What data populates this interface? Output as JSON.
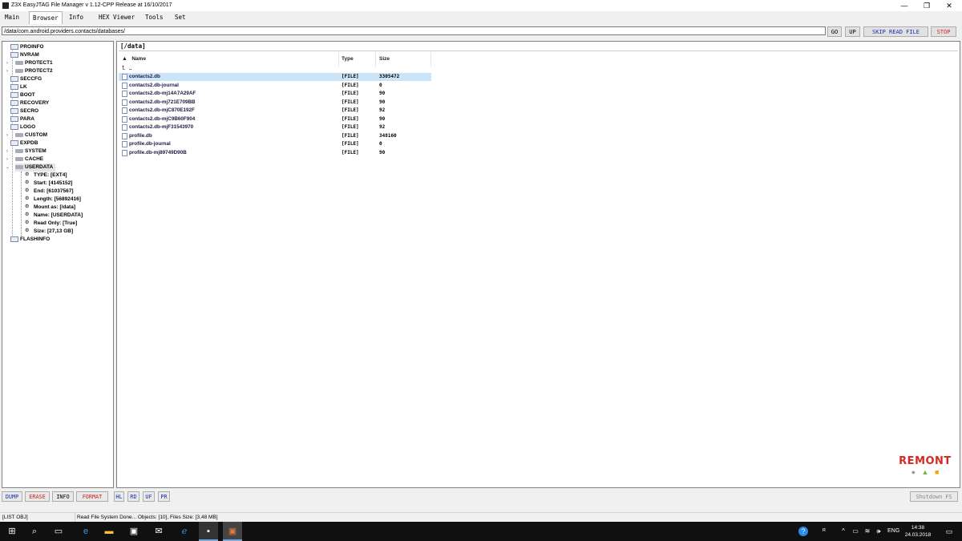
{
  "window": {
    "title": "Z3X EasyJTAG File Manager v 1.12-CPP Release at 16/10/2017",
    "minimize": "—",
    "maximize": "❐",
    "close": "✕"
  },
  "menu": {
    "tabs": [
      "Main",
      "Browser",
      "Info",
      "HEX Viewer",
      "Tools",
      "Set"
    ],
    "active": "Browser"
  },
  "toolbar": {
    "path_value": "/data/com.android.providers.contacts/databases/",
    "go": "GO",
    "up": "UP",
    "skip": "SKIP READ FILE",
    "stop": "STOP"
  },
  "tree": {
    "partitions": [
      "PROINFO",
      "NVRAM",
      "PROTECT1",
      "PROTECT2",
      "SECCFG",
      "LK",
      "BOOT",
      "RECOVERY",
      "SECRO",
      "PARA",
      "LOGO",
      "CUSTOM",
      "EXPDB",
      "SYSTEM",
      "CACHE",
      "USERDATA"
    ],
    "userdata_props": [
      "TYPE: [EXT4]",
      "Start: [4145152]",
      "End: [61037567]",
      "Length: [56892416]",
      "Mount as: [/data]",
      "Name: [USERDATA]",
      "Read Only: [True]",
      "Size: [27,13 GB]"
    ],
    "last": "FLASHINFO"
  },
  "filelist": {
    "current_path": "[/data]",
    "headers": {
      "name": "Name",
      "type": "Type",
      "size": "Size"
    },
    "parent": "..",
    "rows": [
      {
        "name": "contacts2.db",
        "type": "[FILE]",
        "size": "3305472"
      },
      {
        "name": "contacts2.db-journal",
        "type": "[FILE]",
        "size": "0"
      },
      {
        "name": "contacts2.db-mj14A7A29AF",
        "type": "[FILE]",
        "size": "90"
      },
      {
        "name": "contacts2.db-mj721E709BB",
        "type": "[FILE]",
        "size": "90"
      },
      {
        "name": "contacts2.db-mjC870E192F",
        "type": "[FILE]",
        "size": "92"
      },
      {
        "name": "contacts2.db-mjC9B60F904",
        "type": "[FILE]",
        "size": "90"
      },
      {
        "name": "contacts2.db-mjF31543970",
        "type": "[FILE]",
        "size": "92"
      },
      {
        "name": "profile.db",
        "type": "[FILE]",
        "size": "348160"
      },
      {
        "name": "profile.db-journal",
        "type": "[FILE]",
        "size": "0"
      },
      {
        "name": "profile.db-mj89749D90B",
        "type": "[FILE]",
        "size": "90"
      }
    ]
  },
  "bottom_buttons": {
    "dump": "DUMP",
    "erase": "ERASE",
    "info": "INFO",
    "format": "FORMAT",
    "hl": "HL",
    "rd": "RD",
    "uf": "UF",
    "pr": "PR",
    "shutdown": "Shutdown FS"
  },
  "status": {
    "left": "[LIST OBJ]",
    "message": "Read File System Done... Objects: [10], Files Size: [3,48 MB]"
  },
  "logo": {
    "text": "REMONT"
  },
  "taskbar": {
    "lang": "ENG",
    "time": "14:38",
    "date": "24.03.2018",
    "help": "?"
  },
  "colors": {
    "stop": "#e02020",
    "blue_text": "#1a2fb0",
    "red_text": "#d02020",
    "selection": "#cce4f7"
  },
  "icons": [
    "windows-start-icon",
    "search-icon",
    "task-view-icon",
    "edge-icon",
    "file-explorer-icon",
    "store-icon",
    "mail-icon",
    "ie-icon",
    "terminal-icon",
    "easyjtag-icon",
    "apple-icon",
    "android-icon",
    "windows-icon"
  ]
}
